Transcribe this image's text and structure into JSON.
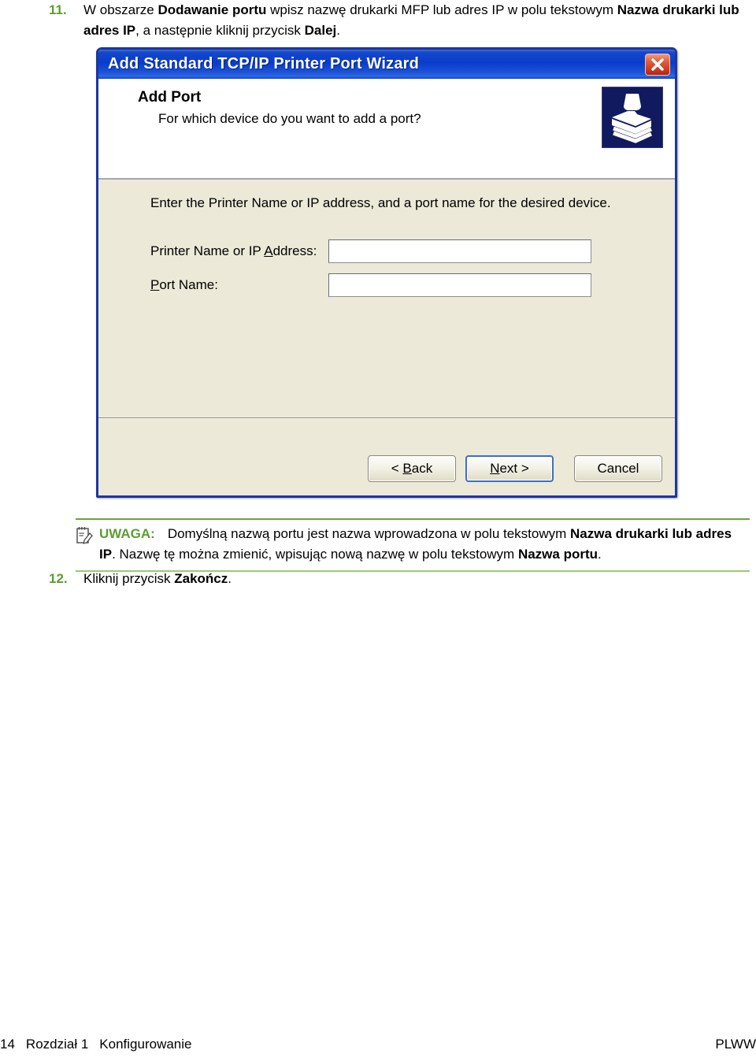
{
  "page": {
    "step11": {
      "number": "11.",
      "text_parts": [
        {
          "t": "W obszarze ",
          "b": false
        },
        {
          "t": "Dodawanie portu",
          "b": true
        },
        {
          "t": " wpisz nazwę drukarki MFP lub adres IP w polu tekstowym ",
          "b": false
        },
        {
          "t": "Nazwa drukarki lub adres IP",
          "b": true
        },
        {
          "t": ", a następnie kliknij przycisk ",
          "b": false
        },
        {
          "t": "Dalej",
          "b": true
        },
        {
          "t": ".",
          "b": false
        }
      ],
      "plain": "W obszarze Dodawanie portu wpisz nazwę drukarki MFP lub adres IP w polu tekstowym Nazwa drukarki lub adres IP, a następnie kliknij przycisk Dalej."
    },
    "step12": {
      "number": "12.",
      "text_parts": [
        {
          "t": "Kliknij przycisk ",
          "b": false
        },
        {
          "t": "Zakończ",
          "b": true
        },
        {
          "t": ".",
          "b": false
        }
      ],
      "plain": "Kliknij przycisk Zakończ."
    },
    "note": {
      "icon": "note-pencil-icon",
      "label": "UWAGA:",
      "text_parts": [
        {
          "t": "Domyślną nazwą portu jest nazwa wprowadzona w polu tekstowym ",
          "b": false
        },
        {
          "t": "Nazwa drukarki lub adres IP",
          "b": true
        },
        {
          "t": ". Nazwę tę można zmienić, wpisując nową nazwę w polu tekstowym ",
          "b": false
        },
        {
          "t": "Nazwa portu",
          "b": true
        },
        {
          "t": ".",
          "b": false
        }
      ],
      "plain": "Domyślną nazwą portu jest nazwa wprowadzona w polu tekstowym Nazwa drukarki lub adres IP. Nazwę tę można zmienić, wpisując nową nazwę w polu tekstowym Nazwa portu.",
      "rule_color_top": "#6aa63a",
      "rule_color_bottom": "#9ec96f",
      "label_color": "#5c9e31"
    },
    "footer": {
      "page_number": "14",
      "chapter": "Rozdział 1",
      "section": "Konfigurowanie",
      "right": "PLWW"
    },
    "accent_green": "#5c9e31"
  },
  "dialog": {
    "titlebar": {
      "title": "Add Standard TCP/IP Printer Port Wizard",
      "close_label": "close-icon",
      "bg_color": "#0a3ccb",
      "close_color": "#c7301a"
    },
    "header": {
      "heading": "Add Port",
      "subheading": "For which device do you want to add a port?",
      "icon": "printer-icon",
      "icon_bg": "#111a5e"
    },
    "body": {
      "instruction": "Enter the Printer Name or IP address, and a port name for the desired device.",
      "fields": [
        {
          "label_pre": "Printer Name or IP ",
          "label_accel": "A",
          "label_post": "ddress:",
          "label_full": "Printer Name or IP Address:",
          "value": "",
          "placeholder": ""
        },
        {
          "label_pre": "",
          "label_accel": "P",
          "label_post": "ort Name:",
          "label_full": "Port Name:",
          "value": "",
          "placeholder": ""
        }
      ],
      "bg_color": "#ece9d8"
    },
    "buttons": [
      {
        "name": "back",
        "pre": "< ",
        "accel": "B",
        "post": "ack",
        "full": "< Back",
        "default": false
      },
      {
        "name": "next",
        "pre": "",
        "accel": "N",
        "post": "ext >",
        "full": "Next >",
        "default": true
      },
      {
        "name": "cancel",
        "pre": "",
        "accel": "",
        "post": "Cancel",
        "full": "Cancel",
        "default": false
      }
    ]
  }
}
